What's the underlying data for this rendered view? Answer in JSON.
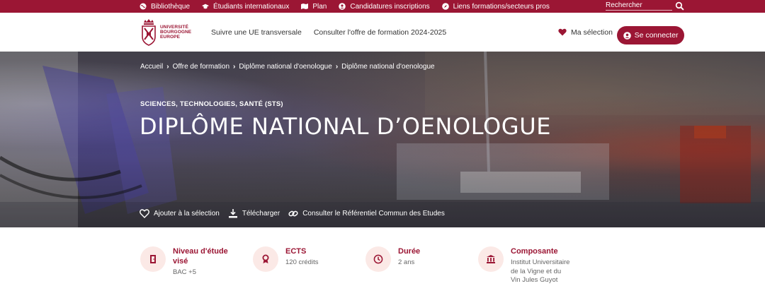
{
  "topbar": {
    "links": [
      {
        "label": "Bibliothèque",
        "icon": "globe-icon"
      },
      {
        "label": "Étudiants internationaux",
        "icon": "graduation-cap-icon"
      },
      {
        "label": "Plan",
        "icon": "map-icon"
      },
      {
        "label": "Candidatures inscriptions",
        "icon": "user-circle-icon"
      },
      {
        "label": "Liens formations/secteurs pros",
        "icon": "compass-icon"
      }
    ],
    "search_placeholder": "Rechercher",
    "search_icon": "search-icon"
  },
  "header": {
    "logo_lines": [
      "UNIVERSITÉ",
      "BOURGOGNE",
      "EUROPE"
    ],
    "nav": [
      "Suivre une UE transversale",
      "Consulter l'offre de formation 2024-2025"
    ],
    "selection_label": "Ma sélection",
    "connect_label": "Se connecter"
  },
  "hero": {
    "breadcrumb": [
      "Accueil",
      "Offre de formation",
      "Diplôme national d'oenologue",
      "Diplôme national d'oenologue"
    ],
    "category": "SCIENCES, TECHNOLOGIES, SANTÉ (STS)",
    "title": "DIPLÔME NATIONAL D’OENOLOGUE",
    "actions": [
      {
        "label": "Ajouter à la sélection",
        "icon": "heart-outline-icon"
      },
      {
        "label": "Télécharger",
        "icon": "download-icon"
      },
      {
        "label": "Consulter le Référentiel Commun des Etudes",
        "icon": "link-icon"
      }
    ]
  },
  "info": {
    "niveau": {
      "label_lines": [
        "Niveau d'étude",
        "visé"
      ],
      "value": "BAC +5"
    },
    "ects": {
      "label": "ECTS",
      "value": "120 crédits"
    },
    "duree": {
      "label": "Durée",
      "value": "2 ans"
    },
    "composante": {
      "label": "Composante",
      "value_lines": [
        "Institut Universitaire",
        "de la Vigne et du",
        "Vin Jules Guyot"
      ]
    }
  },
  "colors": {
    "brand": "#9b1634",
    "icon_bg": "#fbe9e6"
  }
}
